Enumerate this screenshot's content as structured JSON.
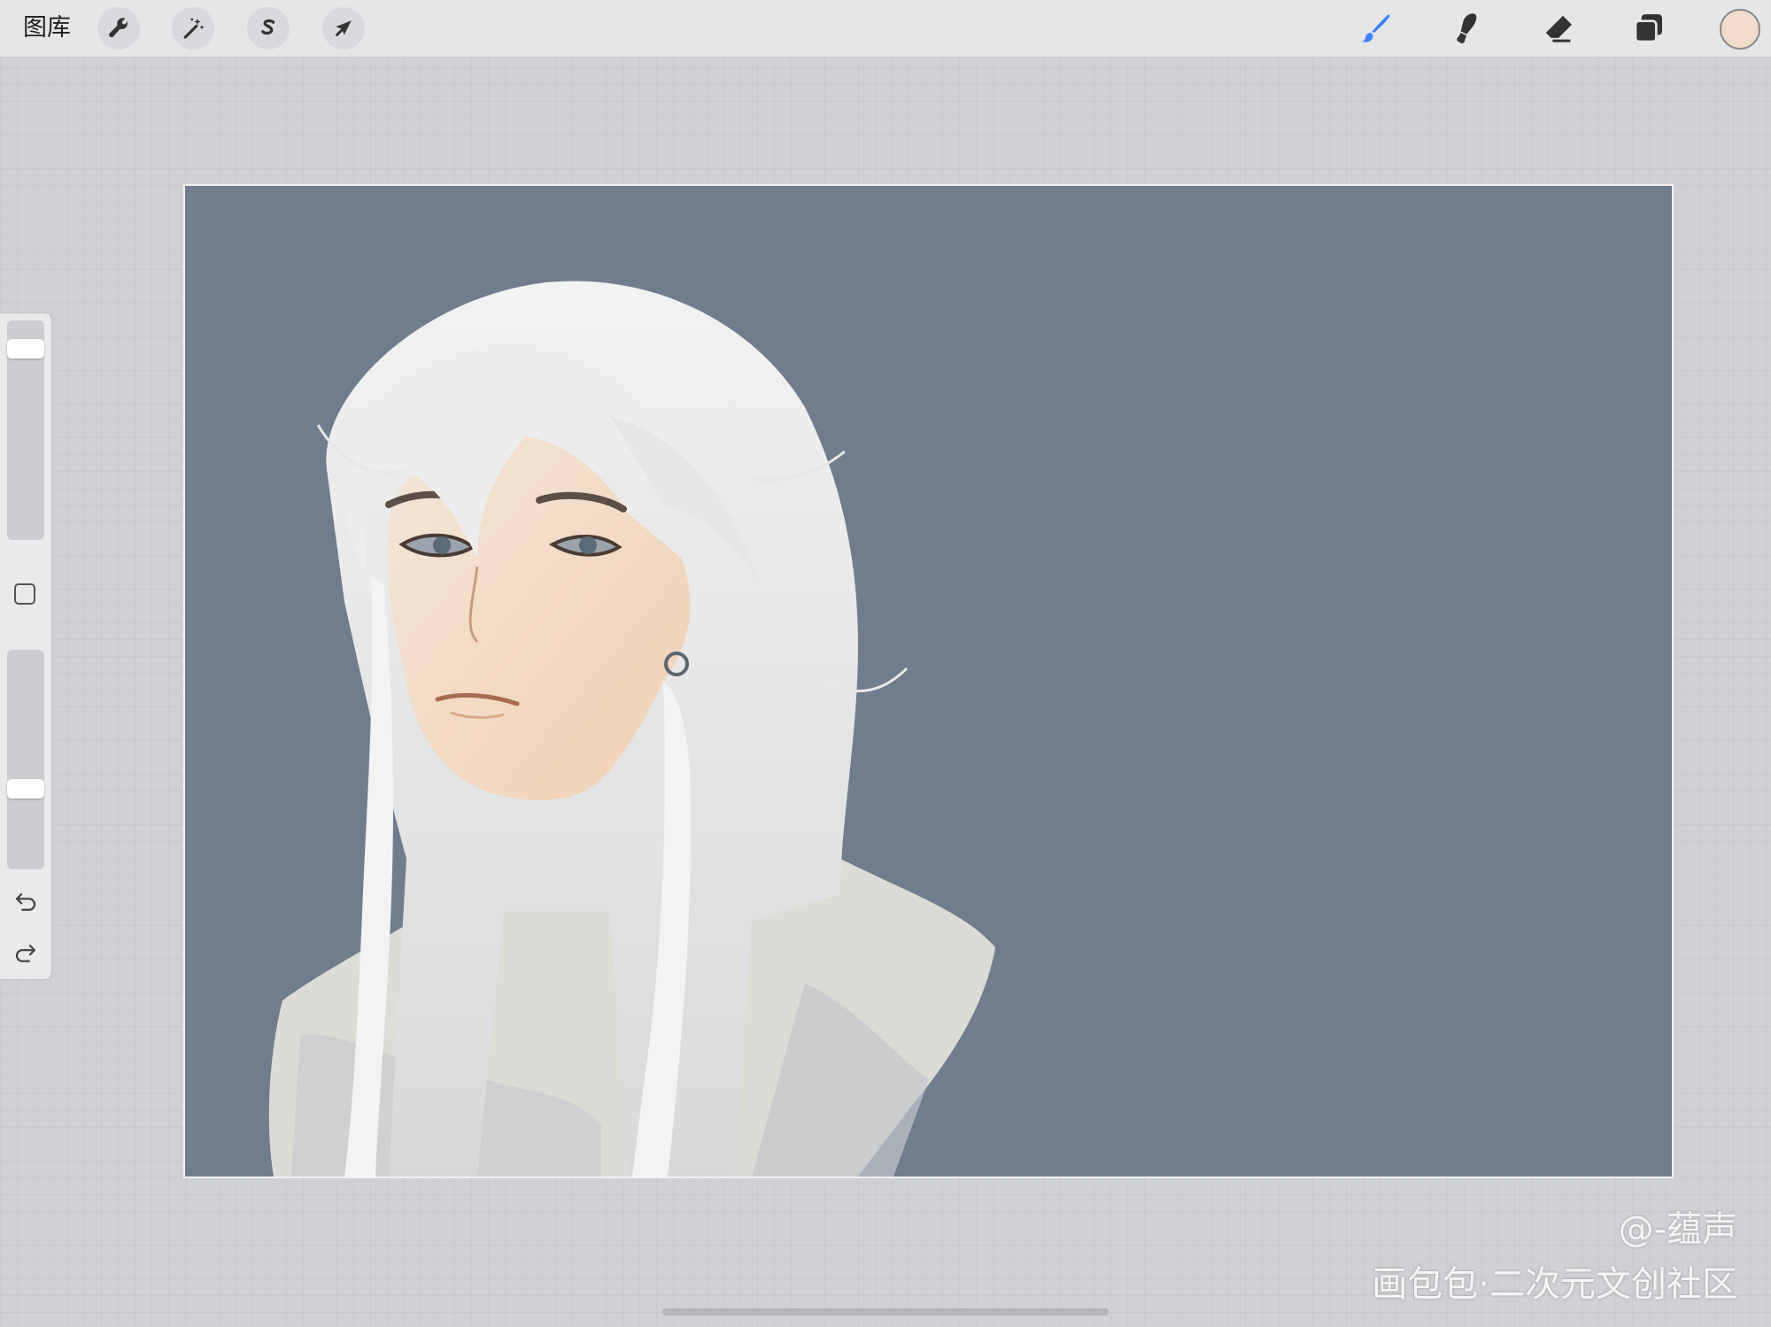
{
  "toolbar": {
    "gallery_label": "图库",
    "left_tools": [
      {
        "name": "actions",
        "icon": "wrench-icon"
      },
      {
        "name": "adjustments",
        "icon": "magic-wand-icon"
      },
      {
        "name": "selection",
        "icon": "selection-s-icon"
      },
      {
        "name": "transform",
        "icon": "arrow-cursor-icon"
      }
    ],
    "right_tools": [
      {
        "name": "brush",
        "icon": "brush-icon",
        "active": true
      },
      {
        "name": "smudge",
        "icon": "smudge-icon"
      },
      {
        "name": "eraser",
        "icon": "eraser-icon"
      },
      {
        "name": "layers",
        "icon": "layers-icon"
      }
    ],
    "active_tool_color": "#3b82f6",
    "current_color": "#f1dcc9"
  },
  "sidebar": {
    "brush_size": 0.92,
    "brush_opacity": 0.35,
    "controls": [
      "modify-button",
      "undo-icon",
      "redo-icon"
    ]
  },
  "canvas": {
    "background_color": "#6f7d8f"
  },
  "watermark": {
    "handle": "@-蕴声",
    "site": "画包包·二次元文创社区"
  }
}
